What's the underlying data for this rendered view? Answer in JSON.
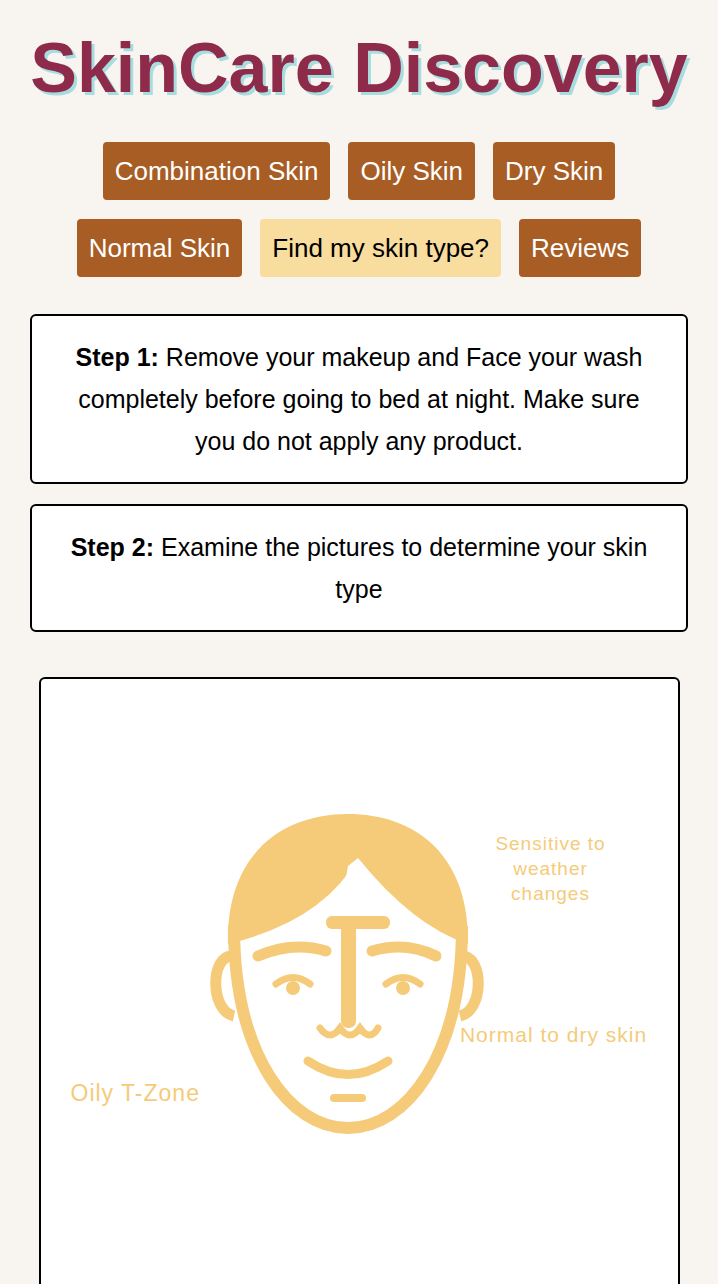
{
  "header": {
    "title": "SkinCare Discovery"
  },
  "nav": [
    {
      "label": "Combination Skin",
      "selected": false
    },
    {
      "label": "Oily Skin",
      "selected": false
    },
    {
      "label": "Dry Skin",
      "selected": false
    },
    {
      "label": "Normal Skin",
      "selected": false
    },
    {
      "label": "Find my skin type?",
      "selected": true
    },
    {
      "label": "Reviews",
      "selected": false
    }
  ],
  "steps": [
    {
      "label": "Step 1:",
      "text": "Remove your makeup and Face your wash completely before going to bed at night. Make sure you do not apply any product."
    },
    {
      "label": "Step 2:",
      "text": "Examine the pictures to determine your skin type"
    }
  ],
  "figure": {
    "labels": {
      "top_right": "Sensitive to weather changes",
      "mid_right": "Normal to dry skin",
      "left": "Oily T-Zone"
    }
  }
}
